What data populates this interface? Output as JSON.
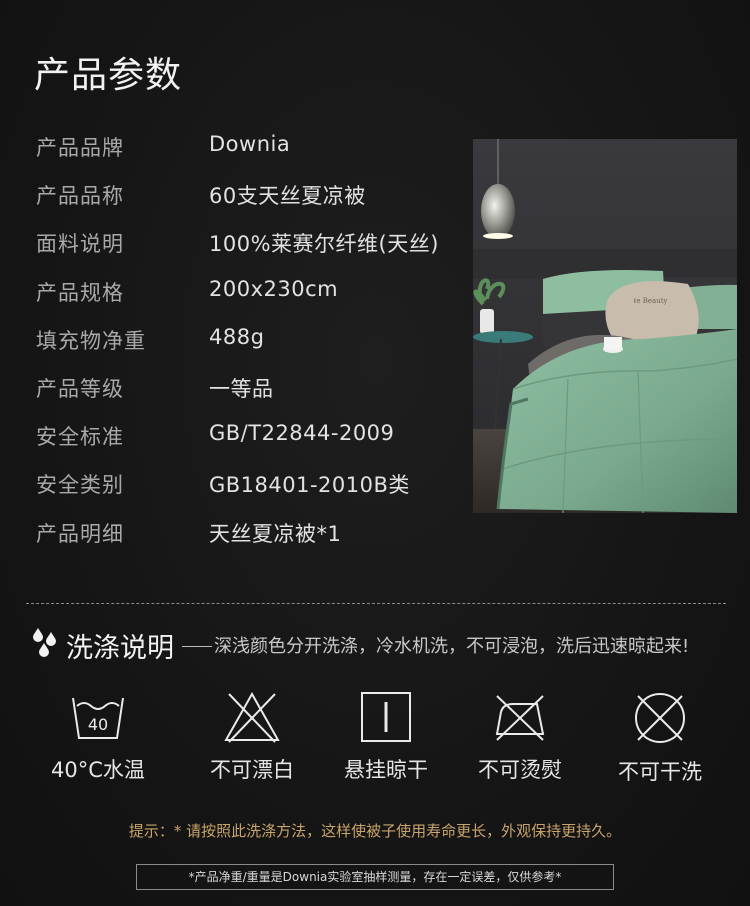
{
  "page_title": "产品参数",
  "params": [
    {
      "key": "产品品牌",
      "value": "Downia"
    },
    {
      "key": "产品品称",
      "value": "60支天丝夏凉被"
    },
    {
      "key": "面料说明",
      "value": "100%莱赛尔纤维(天丝)"
    },
    {
      "key": "产品规格",
      "value": "200x230cm"
    },
    {
      "key": "填充物净重",
      "value": "488g"
    },
    {
      "key": "产品等级",
      "value": "一等品"
    },
    {
      "key": "安全标准",
      "value": "GB/T22844-2009"
    },
    {
      "key": "安全类别",
      "value": "GB18401-2010B类"
    },
    {
      "key": "产品明细",
      "value": "天丝夏凉被*1"
    }
  ],
  "wash": {
    "title": "洗涤说明",
    "description": "深浅颜色分开洗涤，冷水机洗，不可浸泡，洗后迅速晾起来!",
    "icons": [
      {
        "icon": "wash-40-icon",
        "number": "40",
        "label": "40°C水温"
      },
      {
        "icon": "no-bleach-icon",
        "label": "不可漂白"
      },
      {
        "icon": "hang-dry-icon",
        "label": "悬挂晾干"
      },
      {
        "icon": "no-iron-icon",
        "label": "不可烫熨"
      },
      {
        "icon": "no-dry-clean-icon",
        "label": "不可干洗"
      }
    ]
  },
  "tip": "提示：* 请按照此洗涤方法，这样使被子使用寿命更长，外观保持更持久。",
  "note": "*产品净重/重量是Downia实验室抽样测量，存在一定误差，仅供参考*",
  "colors": {
    "background": "#151515",
    "tip": "#c9a46a",
    "quilt": "#7fae92"
  }
}
